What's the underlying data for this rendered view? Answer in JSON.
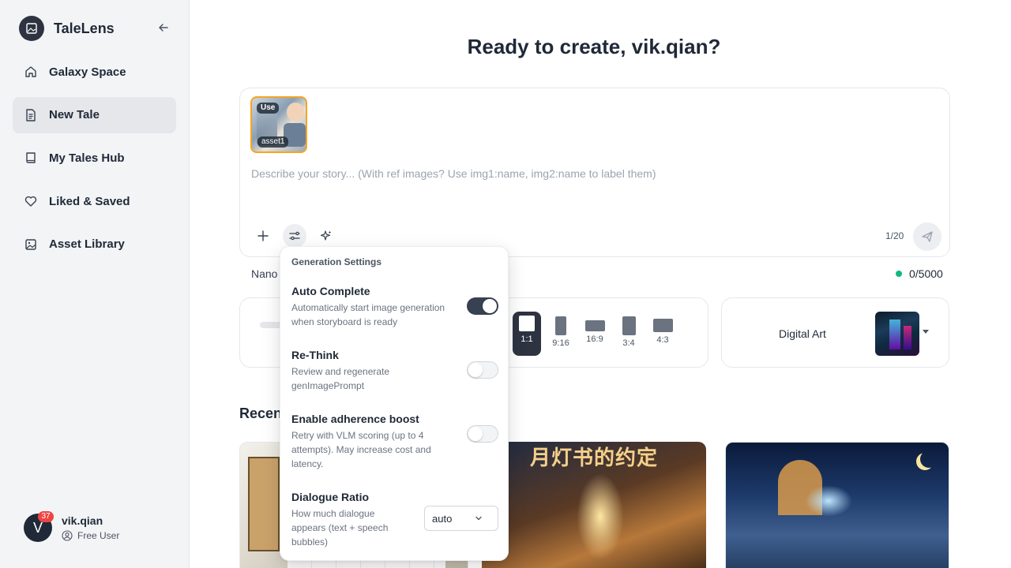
{
  "app": {
    "name": "TaleLens"
  },
  "sidebar": {
    "items": [
      {
        "label": "Galaxy Space",
        "icon": "home-icon"
      },
      {
        "label": "New Tale",
        "icon": "document-icon",
        "active": true
      },
      {
        "label": "My Tales Hub",
        "icon": "book-icon"
      },
      {
        "label": "Liked & Saved",
        "icon": "heart-icon"
      },
      {
        "label": "Asset Library",
        "icon": "image-icon"
      }
    ]
  },
  "user": {
    "initial": "V",
    "name": "vik.qian",
    "plan": "Free User",
    "notifications": "37"
  },
  "main": {
    "title": "Ready to create,  vik.qian?",
    "composer": {
      "ref_tag": "Use",
      "ref_label": "asset1",
      "placeholder": "Describe your story... (With ref images? Use img1:name, img2:name to label them)",
      "counter": "1/20"
    },
    "model_label": "Nano",
    "quota": "0/5000",
    "ratios": [
      "1:1",
      "9:16",
      "16:9",
      "3:4",
      "4:3"
    ],
    "selected_ratio": "1:1",
    "style": {
      "name": "Digital Art"
    },
    "recent_label": "Recen",
    "recent_thumb_title": "月灯书的约定"
  },
  "settings": {
    "title": "Generation Settings",
    "auto_complete": {
      "title": "Auto Complete",
      "desc": "Automatically start image generation when storyboard is ready",
      "on": true
    },
    "rethink": {
      "title": "Re-Think",
      "desc": "Review and regenerate genImagePrompt",
      "on": false
    },
    "adherence": {
      "title": "Enable adherence boost",
      "desc": "Retry with VLM scoring (up to 4 attempts). May increase cost and latency.",
      "on": false
    },
    "dialogue": {
      "title": "Dialogue Ratio",
      "desc": "How much dialogue appears (text + speech bubbles)",
      "value": "auto"
    }
  },
  "colors": {
    "accent": "#2d3340",
    "ref_border": "#f5a524",
    "quota_dot": "#10b981",
    "badge": "#ef4444"
  }
}
